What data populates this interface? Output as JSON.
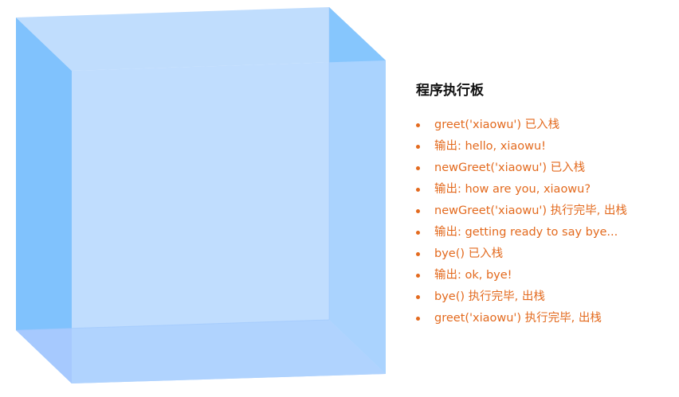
{
  "board": {
    "title": "程序执行板",
    "items": [
      "greet('xiaowu') 已入栈",
      "输出: hello, xiaowu!",
      "newGreet('xiaowu') 已入栈",
      "输出: how are you, xiaowu?",
      "newGreet('xiaowu') 执行完毕, 出栈",
      "输出: getting ready to say bye...",
      "bye() 已入栈",
      "输出: ok, bye!",
      "bye() 执行完毕, 出栈",
      "greet('xiaowu') 执行完毕, 出栈"
    ]
  },
  "colors": {
    "log_text": "#e36a1e",
    "title_text": "#111111",
    "cube_front": "#b2d6fe",
    "cube_top": "#c0ddfd",
    "cube_left": "#80c2fd",
    "cube_right": "#86c6fd",
    "cube_bottom": "#a6c9fe"
  }
}
